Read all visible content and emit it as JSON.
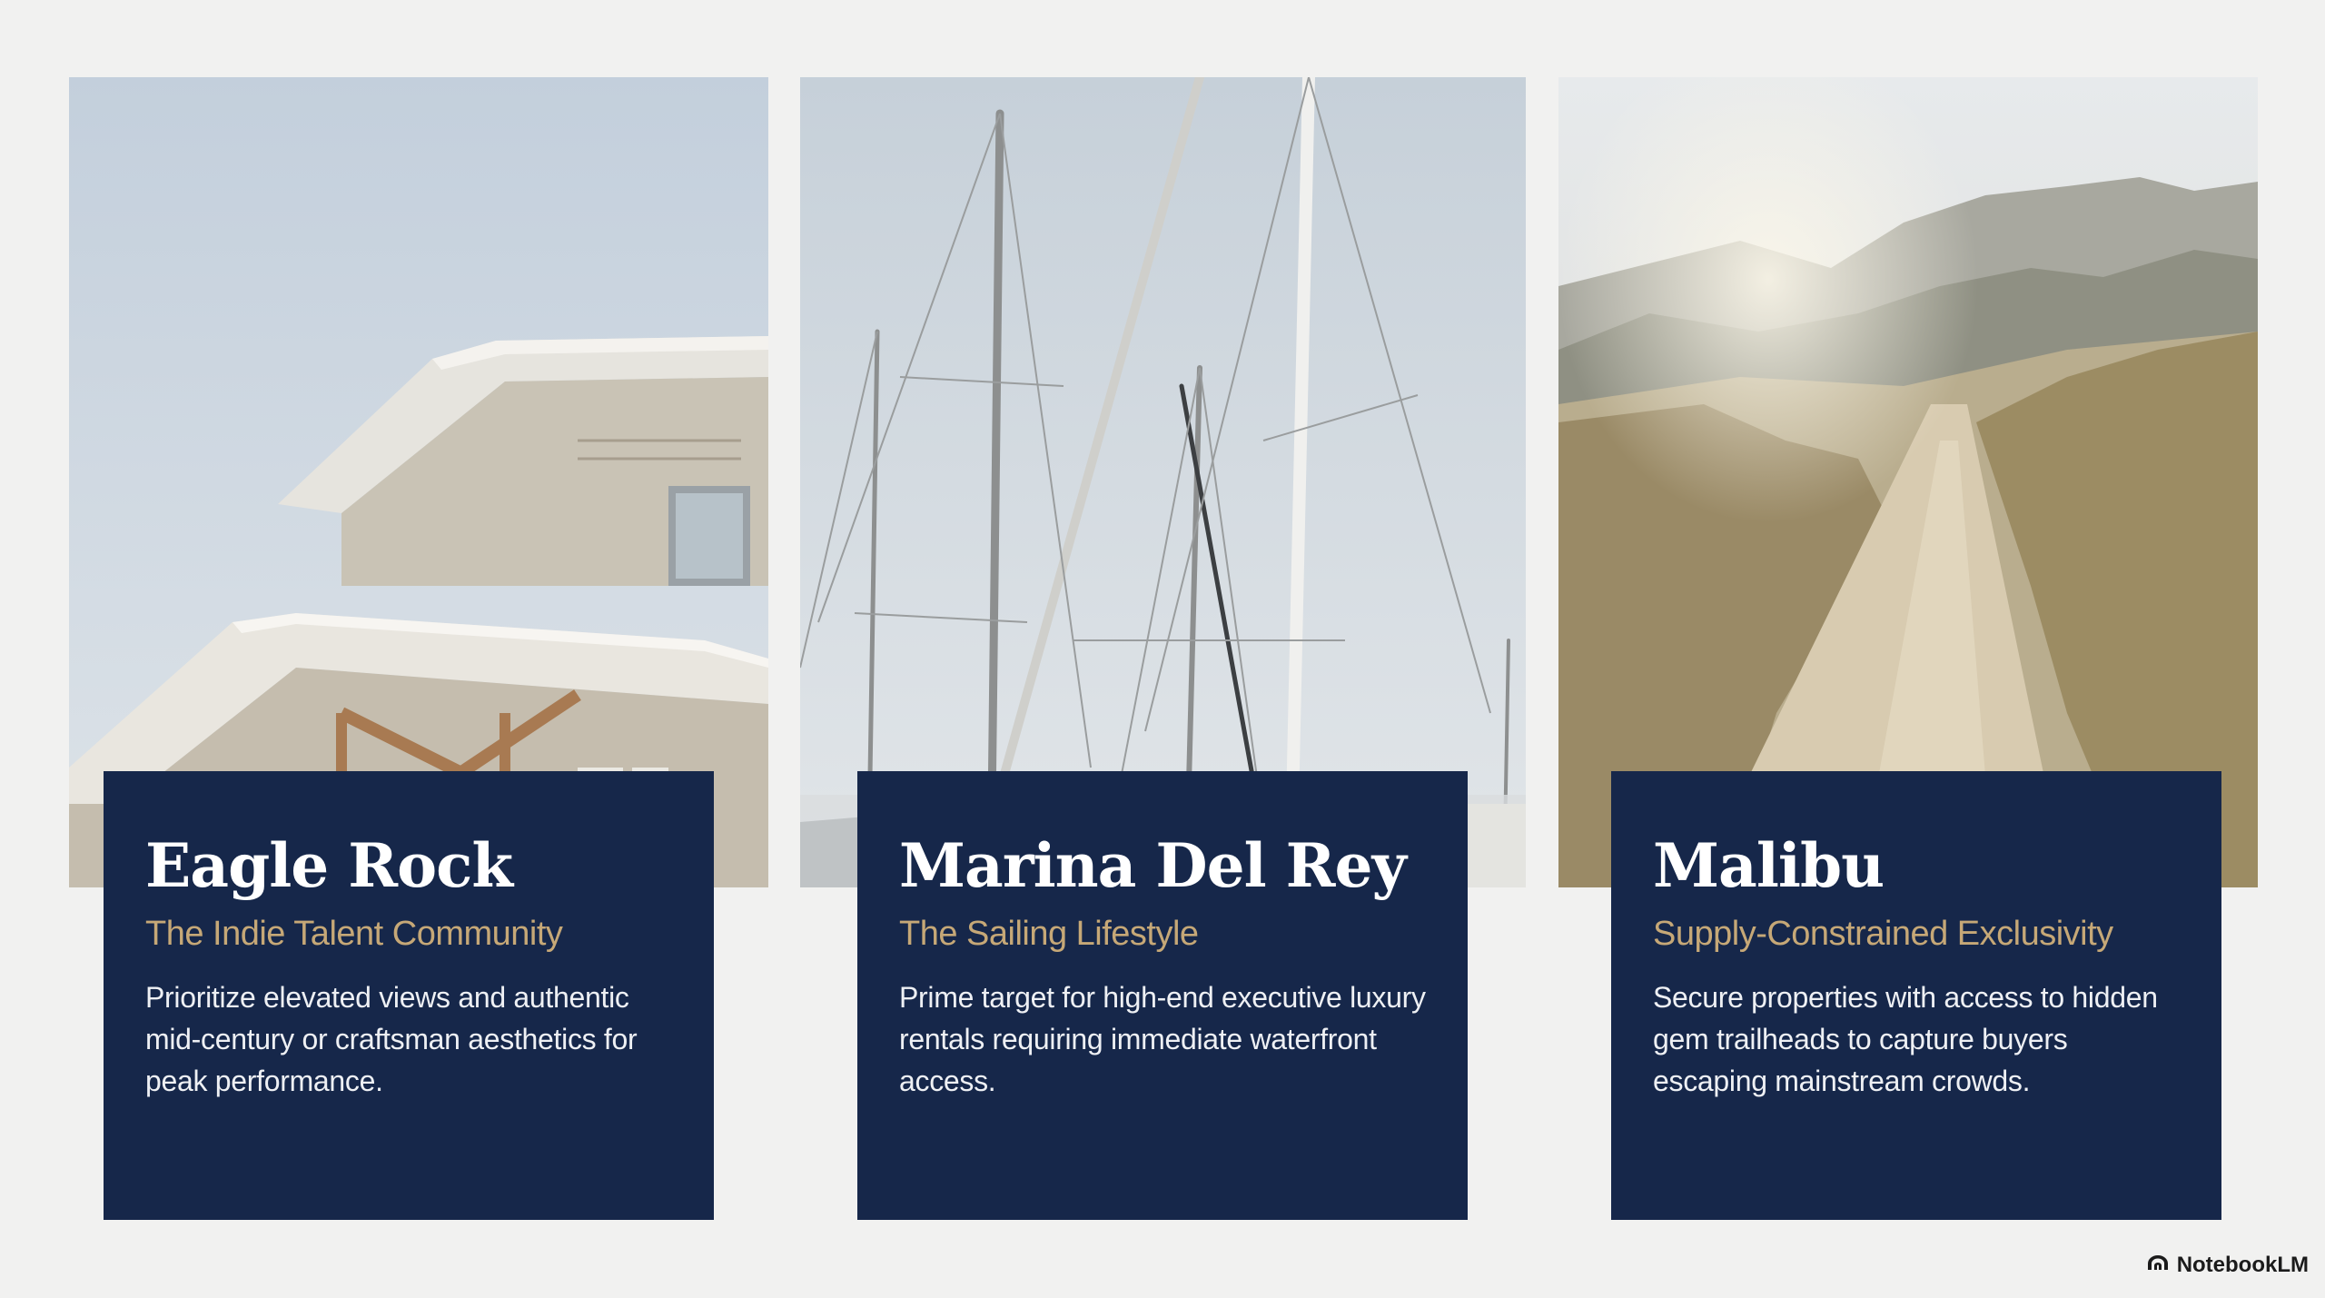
{
  "cards": [
    {
      "image_icon": "house-rooftop-photo",
      "title": "Eagle Rock",
      "subtitle": "The Indie Talent Community",
      "body": "Prioritize elevated views and authentic mid-century or craftsman aesthetics for peak performance."
    },
    {
      "image_icon": "sailboat-masts-photo",
      "title": "Marina Del Rey",
      "subtitle": "The Sailing Lifestyle",
      "body": "Prime target for high-end executive luxury rentals requiring immediate waterfront access."
    },
    {
      "image_icon": "hillside-trail-photo",
      "title": "Malibu",
      "subtitle": "Supply-Constrained Exclusivity",
      "body": "Secure properties with access to hidden gem trailheads to capture buyers escaping mainstream crowds."
    }
  ],
  "brand": {
    "label": "NotebookLM",
    "icon": "notebooklm-logo-icon"
  },
  "colors": {
    "background": "#f1f1f0",
    "card": "#16274a",
    "accent": "#c6a877",
    "title": "#ffffff"
  }
}
